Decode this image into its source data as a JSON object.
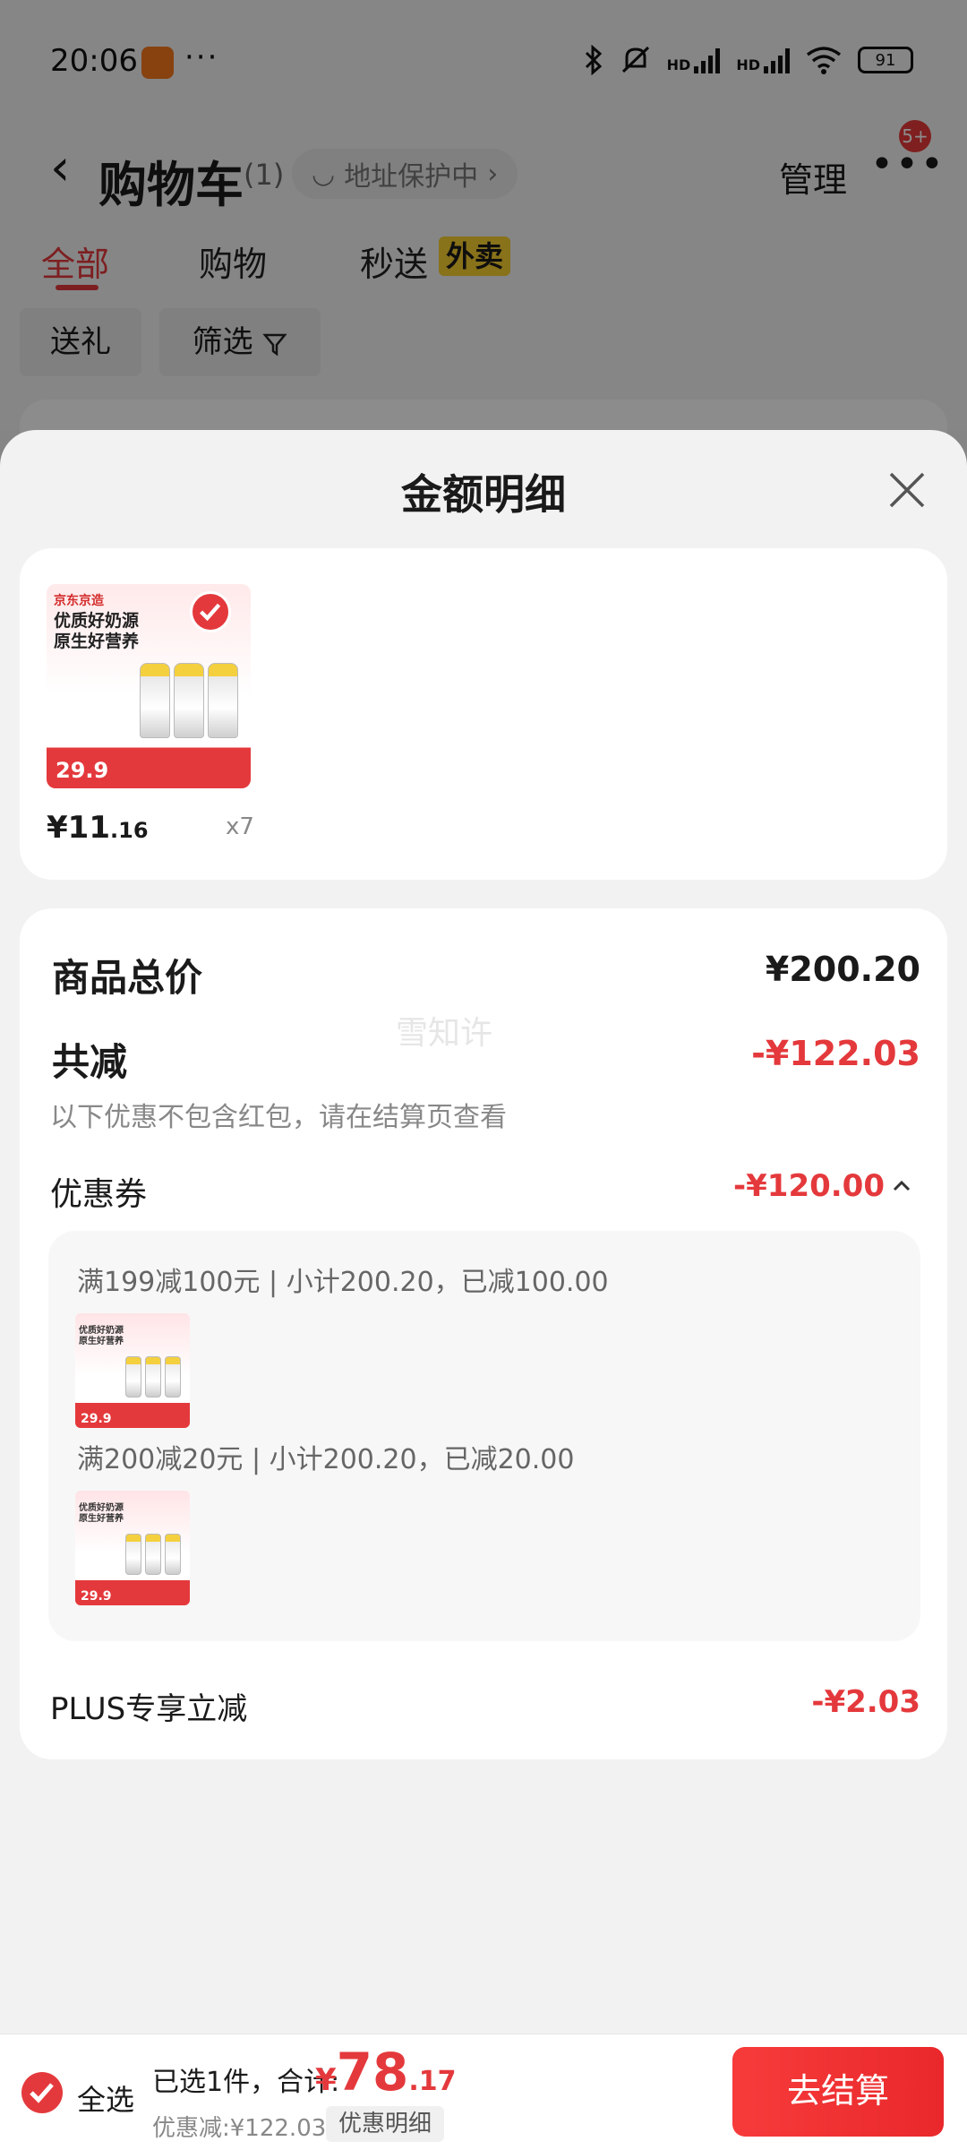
{
  "status_bar": {
    "time": "20:06",
    "dots": "···",
    "hd1": "HD",
    "hd2": "HD",
    "battery": "91"
  },
  "cart_header": {
    "back_glyph": "‹",
    "title": "购物车",
    "count": "(1)",
    "address_pill": "地址保护中",
    "address_chevron": "›",
    "manage_label": "管理",
    "more_glyph": "•••",
    "badge": "5+"
  },
  "tabs": [
    {
      "label": "全部",
      "active": true
    },
    {
      "label": "购物",
      "active": false
    },
    {
      "label": "秒送",
      "active": false
    }
  ],
  "takeout_tag": "外卖",
  "chips": [
    {
      "label": "送礼"
    },
    {
      "label": "筛选"
    }
  ],
  "sheet": {
    "title": "金额明细"
  },
  "product": {
    "image_brand": "京东京造",
    "image_headline_1": "优质好奶源",
    "image_headline_2": "原生好营养",
    "image_price": "29.9",
    "price_currency": "¥",
    "price_integer": "11",
    "price_decimal": ".16",
    "quantity": "x7"
  },
  "details": {
    "goods_total_label": "商品总价",
    "goods_total_value": "¥200.20",
    "watermark": "雪知许",
    "total_discount_label": "共减",
    "total_discount_value": "-¥122.03",
    "note": "以下优惠不包含红包，请在结算页查看",
    "coupon_label": "优惠券",
    "coupon_value": "-¥120.00",
    "coupon_rules": [
      {
        "text": "满199减100元 | 小计200.20，已减100.00",
        "thumb_price": "29.9"
      },
      {
        "text": "满200减20元 | 小计200.20，已减20.00",
        "thumb_price": "29.9"
      }
    ],
    "plus_label": "PLUS专享立减",
    "plus_value": "-¥2.03"
  },
  "bottom_bar": {
    "select_all_label": "全选",
    "selected_text": "已选1件，合计:",
    "total_currency": "¥",
    "total_integer": "78",
    "total_decimal": ".17",
    "discount_text": "优惠减:¥122.03",
    "detail_chip": "优惠明细",
    "checkout_label": "去结算"
  },
  "colors": {
    "accent": "#e4393c",
    "takeout_tag": "#f8d030",
    "overlay": "rgba(0,0,0,0.45)"
  },
  "icons": [
    "bluetooth-icon",
    "mute-icon",
    "signal-icon",
    "wifi-icon",
    "battery-icon",
    "back-icon",
    "close-icon",
    "check-icon",
    "filter-icon",
    "chevron-up-icon"
  ]
}
